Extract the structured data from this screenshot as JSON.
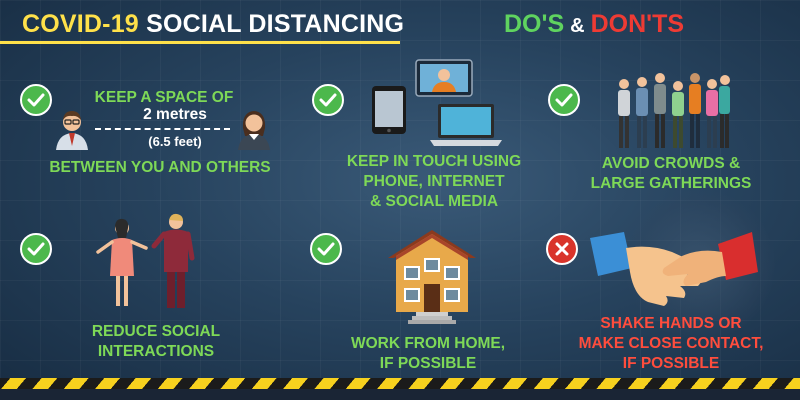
{
  "header": {
    "title_highlight": "COVID-19",
    "title_rest": "SOCIAL DISTANCING",
    "dos": "DO'S",
    "amp": "&",
    "donts": "DON'TS"
  },
  "tips": {
    "space": {
      "status": "do",
      "line1": "KEEP A SPACE OF",
      "distance": "2 metres",
      "distance_alt": "(6.5 feet)",
      "line2": "BETWEEN YOU AND OTHERS"
    },
    "touch": {
      "status": "do",
      "line1": "KEEP IN TOUCH USING",
      "line2": "PHONE, INTERNET",
      "line3": "& SOCIAL MEDIA"
    },
    "crowds": {
      "status": "do",
      "line1": "AVOID CROWDS &",
      "line2": "LARGE GATHERINGS"
    },
    "reduce": {
      "status": "do",
      "line1": "REDUCE SOCIAL",
      "line2": "INTERACTIONS"
    },
    "home": {
      "status": "do",
      "line1": "WORK FROM HOME,",
      "line2": "IF POSSIBLE"
    },
    "shake": {
      "status": "dont",
      "line1": "SHAKE HANDS OR",
      "line2": "MAKE CLOSE CONTACT,",
      "line3": "IF POSSIBLE"
    }
  },
  "colors": {
    "title_yellow": "#ffe14a",
    "do_green": "#7ed957",
    "dont_red": "#ff4d3d",
    "check_badge": "#4cb84c",
    "cross_badge": "#d9342b",
    "hazard_yellow": "#f7d11e"
  },
  "icons": [
    "check-icon",
    "cross-icon",
    "person-icon",
    "phone-icon",
    "laptop-icon",
    "video-call-icon",
    "crowd-icon",
    "couple-icon",
    "house-icon",
    "handshake-icon"
  ]
}
